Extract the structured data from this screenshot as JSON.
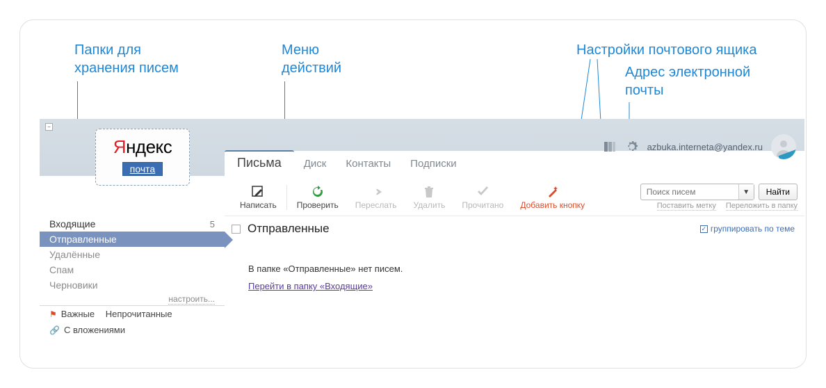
{
  "annotations": {
    "folders_label_l1": "Папки для",
    "folders_label_l2": "хранения писем",
    "actions_label_l1": "Меню",
    "actions_label_l2": "действий",
    "settings_label": "Настройки почтового ящика",
    "email_label_l1": "Адрес электронной",
    "email_label_l2": "почты"
  },
  "logo": {
    "brand_prefix": "Я",
    "brand_rest": "ндекс",
    "sub": "почта"
  },
  "top": {
    "email": "azbuka.interneta@yandex.ru"
  },
  "tabs": {
    "t0": "Письма",
    "t1": "Диск",
    "t2": "Контакты",
    "t3": "Подписки"
  },
  "tools": {
    "compose": "Написать",
    "check": "Проверить",
    "forward": "Переслать",
    "delete": "Удалить",
    "read": "Прочитано",
    "addbtn": "Добавить кнопку"
  },
  "search": {
    "placeholder": "Поиск писем",
    "find": "Найти",
    "mark": "Поставить метку",
    "move": "Переложить в папку"
  },
  "folders": {
    "inbox": "Входящие",
    "inbox_count": "5",
    "sent": "Отправленные",
    "trash": "Удалённые",
    "spam": "Спам",
    "drafts": "Черновики",
    "configure": "настроить...",
    "important": "Важные",
    "unread": "Непрочитанные",
    "attach": "С вложениями"
  },
  "content": {
    "title": "Отправленные",
    "group": "группировать по теме",
    "empty": "В папке «Отправленные» нет писем.",
    "goto": "Перейти в папку «Входящие»"
  }
}
